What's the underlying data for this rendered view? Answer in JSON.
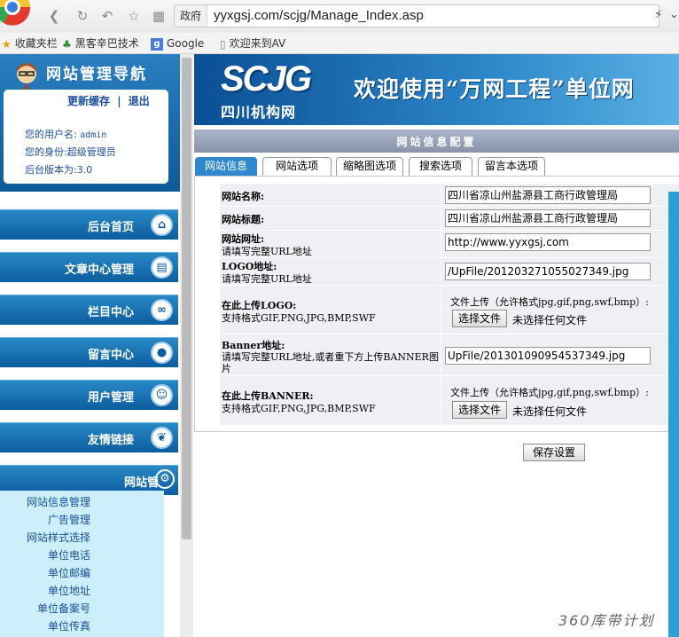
{
  "browser": {
    "address_prefix": "政府",
    "url": "yyxgsj.com/scjg/Manage_Index.asp",
    "bookmarks": [
      "收藏夹栏",
      "黑客辛巴技术",
      "Google",
      "欢迎来到AV"
    ]
  },
  "sidebar": {
    "title": "网站管理导航",
    "refresh_link": "更新缓存",
    "separator": "|",
    "logout_link": "退出",
    "username_label": "您的用户名:",
    "username": "admin",
    "role_label": "您的身份:",
    "role": "超级管理员",
    "version_label": "后台版本为:",
    "version": "3.0",
    "menu": [
      {
        "label": "后台首页",
        "icon": "home-icon"
      },
      {
        "label": "文章中心管理",
        "icon": "document-icon"
      },
      {
        "label": "栏目中心",
        "icon": "link-icon"
      },
      {
        "label": "留言中心",
        "icon": "droplet-icon"
      },
      {
        "label": "用户管理",
        "icon": "user-icon"
      },
      {
        "label": "友情链接",
        "icon": "leaf-icon"
      },
      {
        "label": "网站管",
        "icon": "gear-icon"
      }
    ],
    "submenu": [
      "网站信息管理",
      "广告管理",
      "网站样式选择",
      "单位电话",
      "单位邮编",
      "单位地址",
      "单位备案号",
      "单位传真"
    ]
  },
  "banner": {
    "logo": "SCJG",
    "logo_sub": "四川机构网",
    "welcome": "欢迎使用“万网工程”单位网"
  },
  "section_title": "网站信息配置",
  "tabs": [
    "网站信息",
    "网站选项",
    "缩略图选项",
    "搜索选项",
    "留言本选项"
  ],
  "form": {
    "site_name_label": "网站名称:",
    "site_name_value": "四川省凉山州盐源县工商行政管理局",
    "site_title_label": "网站标题:",
    "site_title_value": "四川省凉山州盐源县工商行政管理局",
    "site_url_label": "网站网址:",
    "site_url_hint": "请填写完整URL地址",
    "site_url_value": "http://www.yyxgsj.com",
    "logo_url_label": "LOGO地址:",
    "logo_url_hint": "请填写完整URL地址",
    "logo_url_value": "/UpFile/201203271055027349.jpg",
    "logo_upload_label": "在此上传LOGO:",
    "logo_upload_hint": "支持格式GIF,PNG,JPG,BMP,SWF",
    "upload_note": "文件上传（允许格式jpg,gif,png,swf,bmp）:",
    "choose_file": "选择文件",
    "no_file": "未选择任何文件",
    "banner_url_label": "Banner地址:",
    "banner_url_hint_1": "请填写完整URL地址,或者重下方上传BANNER图",
    "banner_url_hint_2": "片",
    "banner_url_value": "UpFile/201301090954537349.jpg",
    "banner_upload_label": "在此上传BANNER:",
    "banner_upload_hint": "支持格式GIF,PNG,JPG,BMP,SWF",
    "save_button": "保存设置"
  },
  "watermark": "360库带计划"
}
